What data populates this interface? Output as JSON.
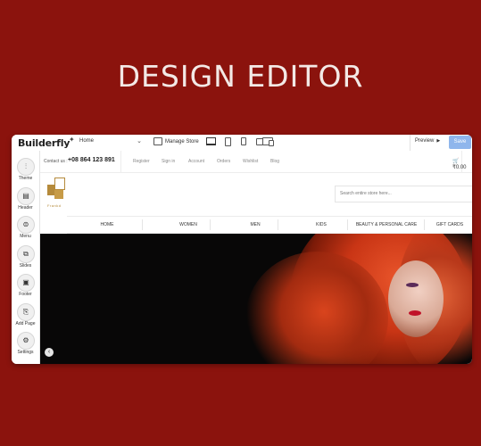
{
  "headline": "DESIGN EDITOR",
  "editor": {
    "logo": "Builderfly",
    "page_select": "Home",
    "manage_store": "Manage Store",
    "preview": "Preview",
    "save": "Save"
  },
  "tools": [
    {
      "label": "Theme",
      "icon": "sliders-icon"
    },
    {
      "label": "Header",
      "icon": "header-icon"
    },
    {
      "label": "Menu",
      "icon": "menu-icon"
    },
    {
      "label": "Slides",
      "icon": "slides-icon"
    },
    {
      "label": "Footer",
      "icon": "footer-icon"
    },
    {
      "label": "Add Page",
      "icon": "add-page-icon"
    },
    {
      "label": "Settings",
      "icon": "settings-icon"
    }
  ],
  "store": {
    "contact_label": "Contact us :",
    "phone": "+08 864 123 891",
    "top_links": [
      "Register",
      "Sign in",
      "Account",
      "Orders",
      "Wishlist",
      "Blog"
    ],
    "cart": "₹0.00",
    "brand_text": "Frankd",
    "search_placeholder": "Search entire store here...",
    "nav": [
      "HOME",
      "WOMEN",
      "MEN",
      "KIDS",
      "BEAUTY & PERSONAL CARE",
      "GIFT CARDS"
    ]
  },
  "colors": {
    "background": "#8b130d",
    "save_button": "#8fb6ec",
    "brand_gold": "#b58a3b"
  }
}
